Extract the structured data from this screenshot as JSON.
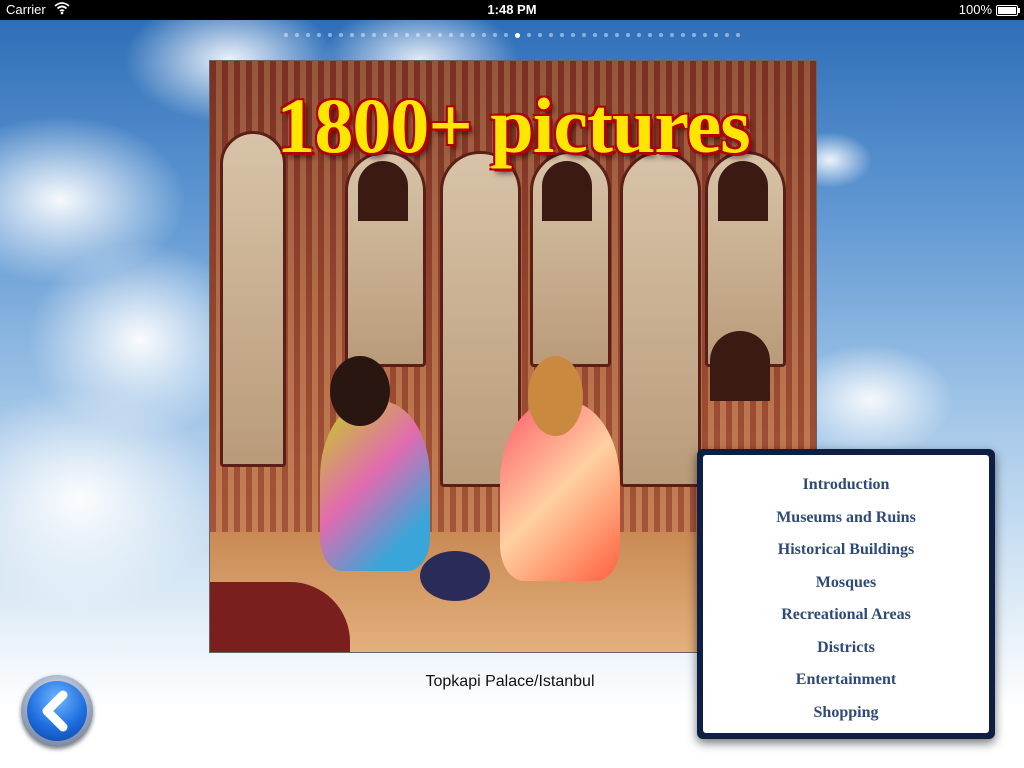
{
  "status_bar": {
    "carrier": "Carrier",
    "time": "1:48 PM",
    "battery": "100%",
    "wifi_icon": "wifi-icon",
    "battery_icon": "battery-icon"
  },
  "pager": {
    "total_pages": 42,
    "current_page": 21
  },
  "photo": {
    "headline": "1800+ pictures",
    "caption": "Topkapi Palace/Istanbul"
  },
  "back_button": {
    "icon": "back-arrow-icon"
  },
  "menu": {
    "items": [
      "Introduction",
      "Museums and Ruins",
      "Historical Buildings",
      "Mosques",
      "Recreational Areas",
      "Districts",
      "Entertainment",
      "Shopping"
    ]
  },
  "colors": {
    "menu_text": "#2f4a7a",
    "menu_border": "#0f1e44",
    "headline_fill": "#ffe600",
    "headline_outline": "#b00000"
  }
}
